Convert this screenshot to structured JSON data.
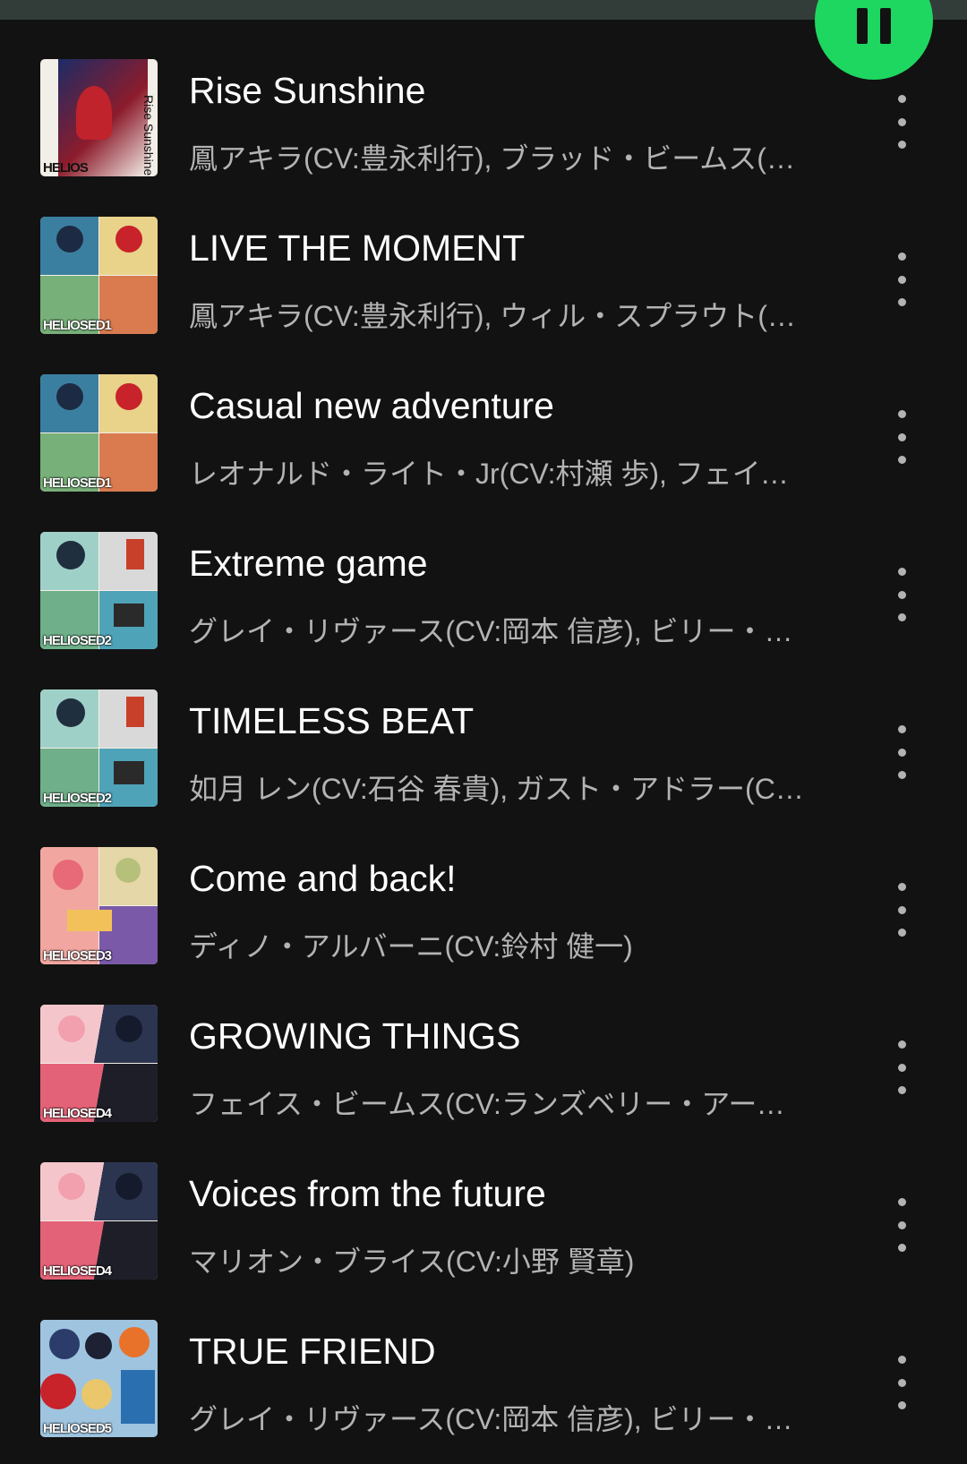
{
  "player": {
    "pause_icon": "pause-icon",
    "accent_color": "#1ed760"
  },
  "tracks": [
    {
      "title": "Rise Sunshine",
      "artists": "鳳アキラ(CV:豊永利行), ブラッド・ビームス(CV:中村悠一)",
      "cover": "Rise Sunshine",
      "cover_label": "HELIOS",
      "cover_side": "Rise Sunshine"
    },
    {
      "title": "LIVE THE MOMENT",
      "artists": "鳳アキラ(CV:豊永利行), ウィル・スプラウト(CV:小林千晃)",
      "cover": "HELIOS ED1",
      "cover_label": "HELIOSED1"
    },
    {
      "title": "Casual new adventure",
      "artists": "レオナルド・ライト・Jr(CV:村瀬 歩), フェイス・ビームス(CV:ランズベリー・アーサー)",
      "cover": "HELIOS ED1",
      "cover_label": "HELIOSED1"
    },
    {
      "title": "Extreme game",
      "artists": "グレイ・リヴァース(CV:岡本 信彦), ビリー・ワイズ(CV:堀江 瞬)",
      "cover": "HELIOS ED2",
      "cover_label": "HELIOSED2"
    },
    {
      "title": "TIMELESS BEAT",
      "artists": "如月 レン(CV:石谷 春貴), ガスト・アドラー(CV:小野友樹)",
      "cover": "HELIOS ED2",
      "cover_label": "HELIOSED2"
    },
    {
      "title": "Come and back!",
      "artists": "ディノ・アルバーニ(CV:鈴村 健一)",
      "cover": "HELIOS ED3",
      "cover_label": "HELIOSED3"
    },
    {
      "title": "GROWING THINGS",
      "artists": "フェイス・ビームス(CV:ランズベリー・アーサー), ジュニア",
      "cover": "HELIOS ED4",
      "cover_label": "HELIOSED4"
    },
    {
      "title": "Voices from the future",
      "artists": "マリオン・ブライス(CV:小野 賢章)",
      "cover": "HELIOS ED4",
      "cover_label": "HELIOSED4"
    },
    {
      "title": "TRUE FRIEND",
      "artists": "グレイ・リヴァース(CV:岡本 信彦), ビリー・ワイズ(CV:堀江 瞬)",
      "cover": "HELIOS ED5",
      "cover_label": "HELIOSED5"
    }
  ]
}
